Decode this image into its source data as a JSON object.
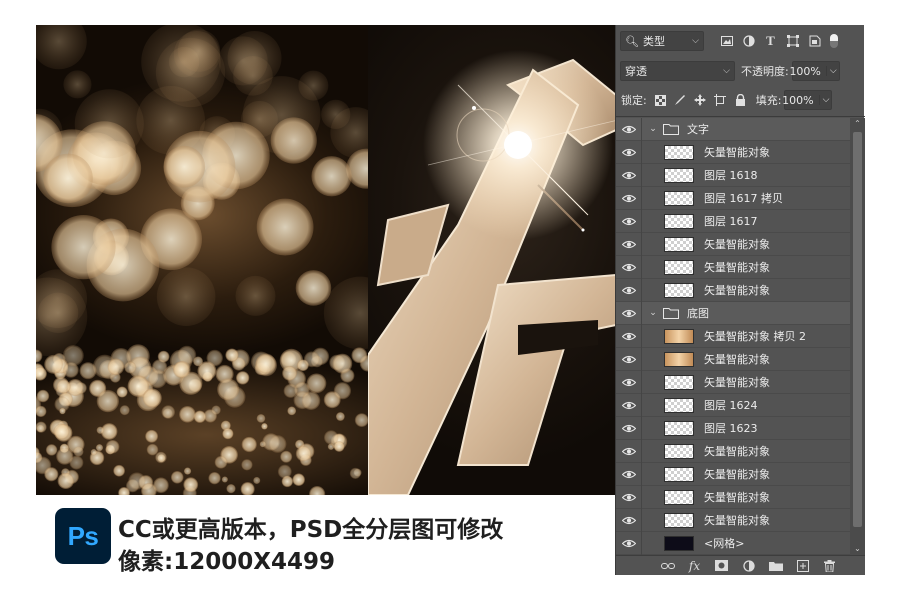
{
  "art": {
    "bokeh_colors": {
      "light": "#fff6df",
      "mid": "#e8c99c",
      "deep": "#b98f5f"
    },
    "letter_colors": {
      "face": "#d8bea0",
      "edge": "#f2e2cc",
      "shadow": "#8a6f55"
    }
  },
  "ps_panel": {
    "filter": {
      "label": "类型",
      "icon": "search-icon"
    },
    "filter_icons": [
      "image-filter-icon",
      "adjustment-filter-icon",
      "text-filter-icon",
      "shape-filter-icon",
      "smart-object-filter-icon",
      "filter-toggle-icon"
    ],
    "blend_mode": "穿透",
    "opacity": {
      "label": "不透明度:",
      "value": "100%"
    },
    "lock": {
      "label": "锁定:",
      "icons": [
        "lock-transparent-icon",
        "lock-image-icon",
        "lock-position-icon",
        "lock-artboard-icon",
        "lock-all-icon"
      ]
    },
    "fill": {
      "label": "填充:",
      "value": "100%"
    },
    "layers": [
      {
        "name": "文字",
        "kind": "group"
      },
      {
        "name": "矢量智能对象",
        "kind": "layer",
        "thumb": "transparent"
      },
      {
        "name": "图层 1618",
        "kind": "layer",
        "thumb": "transparent"
      },
      {
        "name": "图层 1617 拷贝",
        "kind": "layer",
        "thumb": "transparent"
      },
      {
        "name": "图层 1617",
        "kind": "layer",
        "thumb": "transparent"
      },
      {
        "name": "矢量智能对象",
        "kind": "layer",
        "thumb": "transparent"
      },
      {
        "name": "矢量智能对象",
        "kind": "layer",
        "thumb": "transparent"
      },
      {
        "name": "矢量智能对象",
        "kind": "layer",
        "thumb": "transparent"
      },
      {
        "name": "底图",
        "kind": "group"
      },
      {
        "name": "矢量智能对象 拷贝 2",
        "kind": "layer",
        "thumb": "gold"
      },
      {
        "name": "矢量智能对象",
        "kind": "layer",
        "thumb": "gold"
      },
      {
        "name": "矢量智能对象",
        "kind": "layer",
        "thumb": "transparent"
      },
      {
        "name": "图层 1624",
        "kind": "layer",
        "thumb": "transparent"
      },
      {
        "name": "图层 1623",
        "kind": "layer",
        "thumb": "transparent"
      },
      {
        "name": "矢量智能对象",
        "kind": "layer",
        "thumb": "transparent"
      },
      {
        "name": "矢量智能对象",
        "kind": "layer",
        "thumb": "transparent"
      },
      {
        "name": "矢量智能对象",
        "kind": "layer",
        "thumb": "transparent"
      },
      {
        "name": "矢量智能对象",
        "kind": "layer",
        "thumb": "transparent"
      },
      {
        "name": "<网格>",
        "kind": "layer",
        "thumb": "dark"
      }
    ],
    "bottom_icons": [
      "link-layers-icon",
      "fx-icon",
      "layer-mask-icon",
      "adjustment-layer-icon",
      "new-group-icon",
      "new-layer-icon",
      "trash-icon"
    ],
    "fx_label": "fx"
  },
  "caption": {
    "logo_text": "Ps",
    "line1": "CC或更高版本，PSD全分层图可修改",
    "line2": "像素:12000X4499"
  }
}
